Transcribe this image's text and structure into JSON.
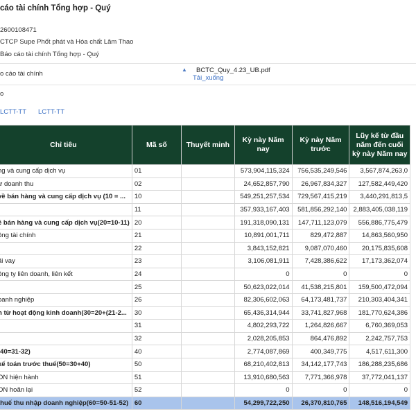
{
  "page_title": "cáo tài chính Tổng hợp - Quý",
  "company_code": "2600108471",
  "company_name": "CTCP Supe Phốt phát và Hóa chất Lâm Thao",
  "report_type": "Báo cáo tài chính Tổng hợp - Quý",
  "file_row": {
    "label": "o cáo tài chính",
    "file_name": "BCTC_Quy_4.23_UB.pdf",
    "download_label": "Tải_xuống"
  },
  "small_label": "o",
  "tab_links": [
    "LCTT-TT",
    "LCTT-TT"
  ],
  "table": {
    "headers": {
      "indicator": "Chỉ tiêu",
      "code": "Mã số",
      "note": "Thuyết minh",
      "current": "Kỳ này Năm nay",
      "previous": "Kỳ này Năm trước",
      "ytd": "Lũy kế từ đầu năm đến cuối kỳ này Năm nay"
    },
    "rows": [
      {
        "name": "ng và cung cấp dịch vụ",
        "code": "01",
        "note": "",
        "current": "573,904,115,324",
        "previous": "756,535,249,546",
        "ytd": "3,567,874,263,0",
        "bold": false
      },
      {
        "name": "ừ doanh thu",
        "code": "02",
        "note": "",
        "current": "24,652,857,790",
        "previous": "26,967,834,327",
        "ytd": "127,582,449,420",
        "bold": false
      },
      {
        "name": "về bán hàng và cung cấp dịch vụ (10 = ...",
        "code": "10",
        "note": "",
        "current": "549,251,257,534",
        "previous": "729,567,415,219",
        "ytd": "3,440,291,813,5",
        "bold": true
      },
      {
        "name": "",
        "code": "11",
        "note": "",
        "current": "357,933,167,403",
        "previous": "581,856,292,140",
        "ytd": "2,883,405,038,119",
        "bold": false
      },
      {
        "name": "ề bán hàng và cung cấp dịch vụ(20=10-11)",
        "code": "20",
        "note": "",
        "current": "191,318,090,131",
        "previous": "147,711,123,079",
        "ytd": "556,886,775,479",
        "bold": true
      },
      {
        "name": "ộng tài chính",
        "code": "21",
        "note": "",
        "current": "10,891,001,711",
        "previous": "829,472,887",
        "ytd": "14,863,560,950",
        "bold": false
      },
      {
        "name": "",
        "code": "22",
        "note": "",
        "current": "3,843,152,821",
        "previous": "9,087,070,460",
        "ytd": "20,175,835,608",
        "bold": false
      },
      {
        "name": "ãi vay",
        "code": "23",
        "note": "",
        "current": "3,106,081,911",
        "previous": "7,428,386,622",
        "ytd": "17,173,362,074",
        "bold": false
      },
      {
        "name": "ông ty liên doanh, liên kết",
        "code": "24",
        "note": "",
        "current": "0",
        "previous": "0",
        "ytd": "0",
        "bold": false
      },
      {
        "name": "",
        "code": "25",
        "note": "",
        "current": "50,623,022,014",
        "previous": "41,538,215,801",
        "ytd": "159,500,472,094",
        "bold": false
      },
      {
        "name": "oanh nghiệp",
        "code": "26",
        "note": "",
        "current": "82,306,602,063",
        "previous": "64,173,481,737",
        "ytd": "210,303,404,341",
        "bold": false
      },
      {
        "name": "n từ hoạt động kinh doanh(30=20+(21-2...",
        "code": "30",
        "note": "",
        "current": "65,436,314,944",
        "previous": "33,741,827,968",
        "ytd": "181,770,624,386",
        "bold": true
      },
      {
        "name": "",
        "code": "31",
        "note": "",
        "current": "4,802,293,722",
        "previous": "1,264,826,667",
        "ytd": "6,760,369,053",
        "bold": false
      },
      {
        "name": "",
        "code": "32",
        "note": "",
        "current": "2,028,205,853",
        "previous": "864,476,892",
        "ytd": "2,242,757,753",
        "bold": false
      },
      {
        "name": "(40=31-32)",
        "code": "40",
        "note": "",
        "current": "2,774,087,869",
        "previous": "400,349,775",
        "ytd": "4,517,611,300",
        "bold": true
      },
      {
        "name": "kế toán trước thuế(50=30+40)",
        "code": "50",
        "note": "",
        "current": "68,210,402,813",
        "previous": "34,142,177,743",
        "ytd": "186,288,235,686",
        "bold": true
      },
      {
        "name": "ON hiện hành",
        "code": "51",
        "note": "",
        "current": "13,910,680,563",
        "previous": "7,771,366,978",
        "ytd": "37,772,041,137",
        "bold": false
      },
      {
        "name": "ON hoãn lại",
        "code": "52",
        "note": "",
        "current": "0",
        "previous": "0",
        "ytd": "0",
        "bold": false
      },
      {
        "name": "thuế thu nhập doanh nghiệp(60=50-51-52)",
        "code": "60",
        "note": "",
        "current": "54,299,722,250",
        "previous": "26,370,810,765",
        "ytd": "148,516,194,549",
        "bold": true,
        "highlight": true
      }
    ]
  }
}
